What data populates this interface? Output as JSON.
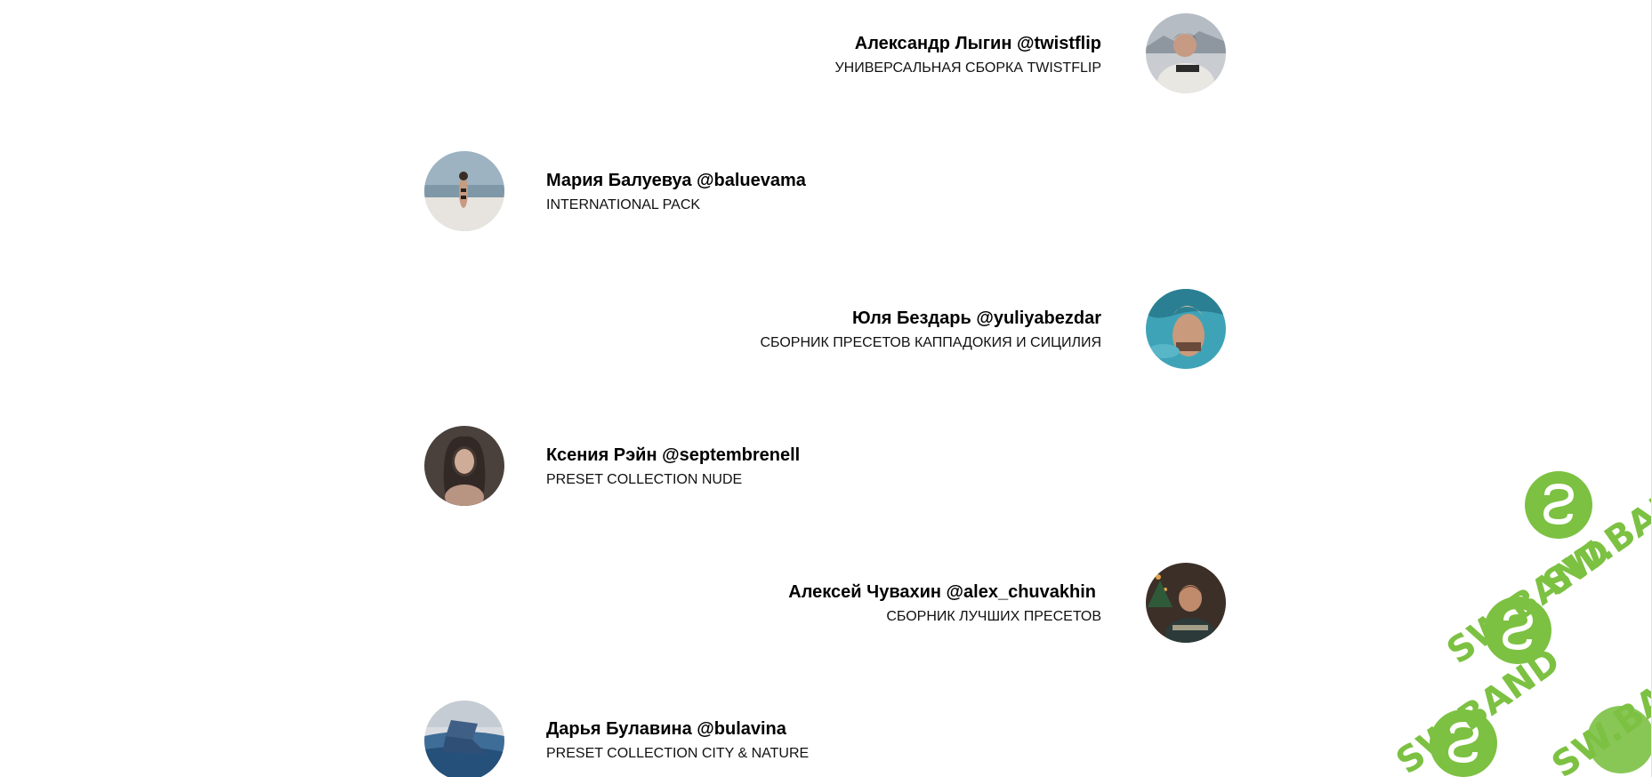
{
  "people": [
    {
      "name": "Александр Лыгин @twistflip",
      "subtitle": "УНИВЕРСАЛЬНАЯ СБОРКА TWISTFLIP",
      "avatar": "person-photo-icon"
    },
    {
      "name": "Мария Балуевуа @baluevama",
      "subtitle": "INTERNATIONAL PACK",
      "avatar": "person-photo-icon"
    },
    {
      "name": "Юля Бездарь @yuliyabezdar",
      "subtitle": "СБОРНИК ПРЕСЕТОВ КАППАДОКИЯ И СИЦИЛИЯ",
      "avatar": "person-photo-icon"
    },
    {
      "name": "Ксения Рэйн @septembrenell",
      "subtitle": "PRESET COLLECTION NUDE",
      "avatar": "person-photo-icon"
    },
    {
      "name": "Алексей Чувахин @alex_chuvakhin",
      "subtitle": "СБОРНИК ЛУЧШИХ ПРЕСЕТОВ",
      "avatar": "person-photo-icon"
    },
    {
      "name": "Дарья Булавина @bulavina",
      "subtitle": "PRESET COLLECTION CITY & NATURE",
      "avatar": "person-photo-icon"
    }
  ],
  "watermark": {
    "text": "SW.BAND",
    "color": "#7cc142"
  }
}
